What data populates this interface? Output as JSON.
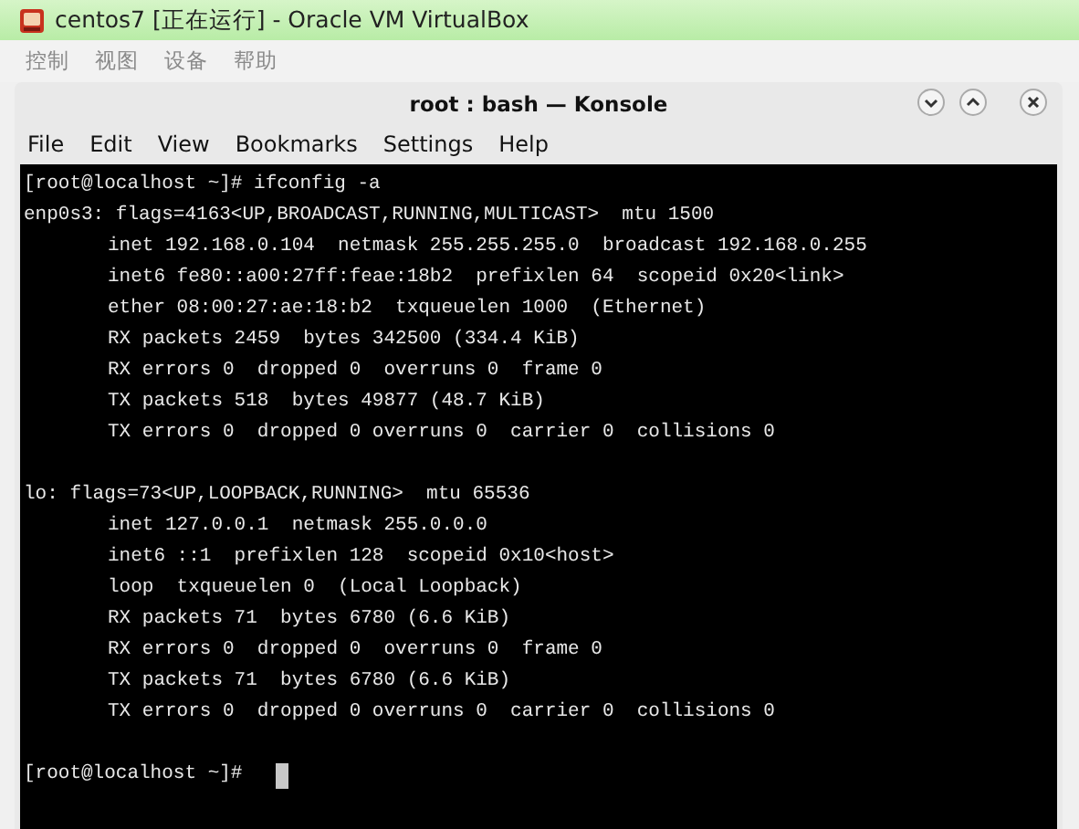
{
  "window": {
    "title": "centos7 [正在运行] - Oracle VM VirtualBox"
  },
  "vm_menu": [
    "控制",
    "视图",
    "设备",
    "帮助"
  ],
  "konsole": {
    "title": "root : bash — Konsole",
    "menu": [
      "File",
      "Edit",
      "View",
      "Bookmarks",
      "Settings",
      "Help"
    ],
    "terminal": {
      "command": "[root@localhost ~]# ifconfig -a",
      "interfaces": [
        {
          "header": "enp0s3: flags=4163<UP,BROADCAST,RUNNING,MULTICAST>  mtu 1500",
          "details": [
            "inet 192.168.0.104  netmask 255.255.255.0  broadcast 192.168.0.255",
            "inet6 fe80::a00:27ff:feae:18b2  prefixlen 64  scopeid 0x20<link>",
            "ether 08:00:27:ae:18:b2  txqueuelen 1000  (Ethernet)",
            "RX packets 2459  bytes 342500 (334.4 KiB)",
            "RX errors 0  dropped 0  overruns 0  frame 0",
            "TX packets 518  bytes 49877 (48.7 KiB)",
            "TX errors 0  dropped 0 overruns 0  carrier 0  collisions 0"
          ]
        },
        {
          "header": "lo: flags=73<UP,LOOPBACK,RUNNING>  mtu 65536",
          "details": [
            "inet 127.0.0.1  netmask 255.0.0.0",
            "inet6 ::1  prefixlen 128  scopeid 0x10<host>",
            "loop  txqueuelen 0  (Local Loopback)",
            "RX packets 71  bytes 6780 (6.6 KiB)",
            "RX errors 0  dropped 0  overruns 0  frame 0",
            "TX packets 71  bytes 6780 (6.6 KiB)",
            "TX errors 0  dropped 0 overruns 0  carrier 0  collisions 0"
          ]
        }
      ],
      "prompt": "[root@localhost ~]#"
    }
  }
}
